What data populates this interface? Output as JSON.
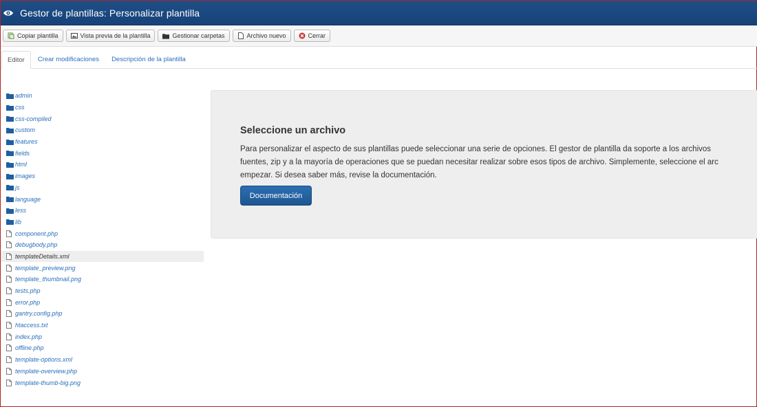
{
  "header": {
    "title": "Gestor de plantillas: Personalizar plantilla",
    "icon": "eye-icon"
  },
  "toolbar": {
    "buttons": [
      {
        "label": "Copiar plantilla",
        "icon": "copy-icon"
      },
      {
        "label": "Vista previa de la plantilla",
        "icon": "image-icon"
      },
      {
        "label": "Gestionar carpetas",
        "icon": "folder-icon"
      },
      {
        "label": "Archivo nuevo",
        "icon": "file-icon"
      },
      {
        "label": "Cerrar",
        "icon": "close-icon"
      }
    ]
  },
  "tabs": [
    {
      "label": "Editor",
      "active": true
    },
    {
      "label": "Crear modificaciones",
      "active": false
    },
    {
      "label": "Descripción de la plantilla",
      "active": false
    }
  ],
  "tree": {
    "items": [
      {
        "label": "admin",
        "type": "folder"
      },
      {
        "label": "css",
        "type": "folder"
      },
      {
        "label": "css-compiled",
        "type": "folder"
      },
      {
        "label": "custom",
        "type": "folder"
      },
      {
        "label": "features",
        "type": "folder"
      },
      {
        "label": "fields",
        "type": "folder"
      },
      {
        "label": "html",
        "type": "folder"
      },
      {
        "label": "images",
        "type": "folder"
      },
      {
        "label": "js",
        "type": "folder"
      },
      {
        "label": "language",
        "type": "folder"
      },
      {
        "label": "less",
        "type": "folder"
      },
      {
        "label": "lib",
        "type": "folder"
      },
      {
        "label": "component.php",
        "type": "file"
      },
      {
        "label": "debugbody.php",
        "type": "file"
      },
      {
        "label": "templateDetails.xml",
        "type": "file",
        "selected": true
      },
      {
        "label": "template_preview.png",
        "type": "file"
      },
      {
        "label": "template_thumbnail.png",
        "type": "file"
      },
      {
        "label": "tests.php",
        "type": "file"
      },
      {
        "label": "error.php",
        "type": "file"
      },
      {
        "label": "gantry.config.php",
        "type": "file"
      },
      {
        "label": "htaccess.txt",
        "type": "file"
      },
      {
        "label": "index.php",
        "type": "file"
      },
      {
        "label": "offline.php",
        "type": "file"
      },
      {
        "label": "template-options.xml",
        "type": "file"
      },
      {
        "label": "template-overview.php",
        "type": "file"
      },
      {
        "label": "template-thumb-big.png",
        "type": "file"
      }
    ]
  },
  "main": {
    "heading": "Seleccione un archivo",
    "paragraph_lines": [
      "Para personalizar el aspecto de sus plantillas puede seleccionar una serie de opciones. El gestor de plantilla da soporte a los archivos",
      "fuentes, zip y a la mayoría de operaciones que se puedan necesitar realizar sobre esos tipos de archivo. Simplemente, seleccione el arc",
      "empezar. Si desea saber más, revise la documentación."
    ],
    "doc_button": "Documentación"
  },
  "colors": {
    "header": "#1f4f86",
    "link": "#2a6ebb",
    "primary_button": "#1e5690"
  }
}
